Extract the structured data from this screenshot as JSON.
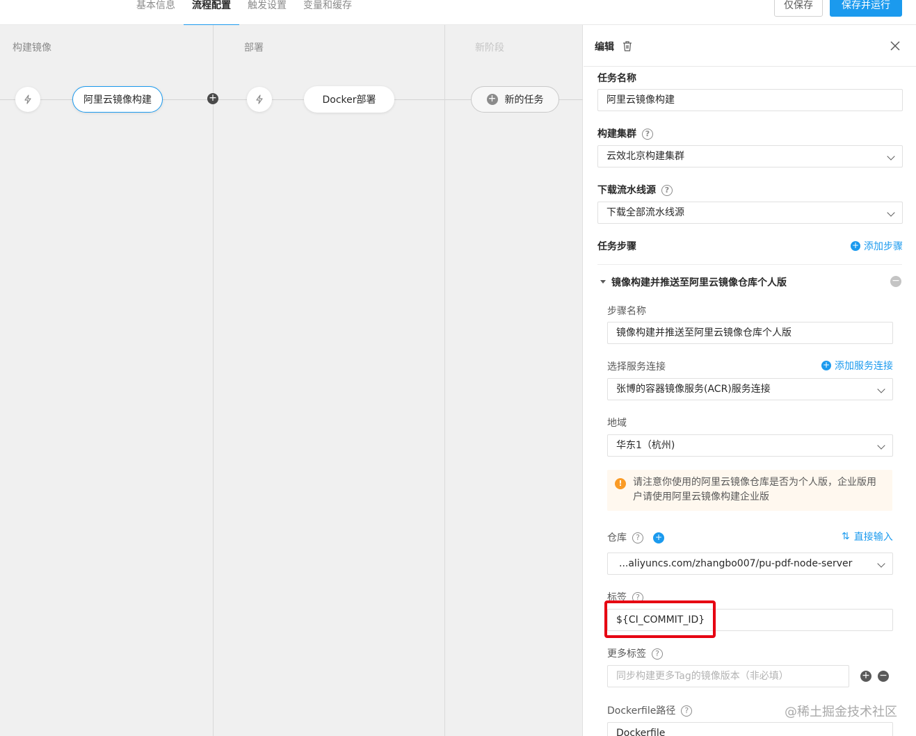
{
  "tabs": [
    "基本信息",
    "流程配置",
    "触发设置",
    "变量和缓存"
  ],
  "active_tab": "流程配置",
  "buttons": {
    "save": "仅保存",
    "save_run": "保存并运行"
  },
  "stages": [
    {
      "title": "构建镜像",
      "job": "阿里云镜像构建"
    },
    {
      "title": "部署",
      "job": "Docker部署"
    },
    {
      "title": "新阶段",
      "job": "新的任务"
    }
  ],
  "panel": {
    "title": "编辑",
    "task_name_label": "任务名称",
    "task_name_value": "阿里云镜像构建",
    "cluster_label": "构建集群",
    "cluster_value": "云效北京构建集群",
    "source_label": "下载流水线源",
    "source_value": "下载全部流水线源",
    "steps_label": "任务步骤",
    "add_step": "添加步骤",
    "step_title": "镜像构建并推送至阿里云镜像仓库个人版",
    "step_name_label": "步骤名称",
    "step_name_value": "镜像构建并推送至阿里云镜像仓库个人版",
    "service_label": "选择服务连接",
    "add_service": "添加服务连接",
    "service_value": "张博的容器镜像服务(ACR)服务连接",
    "region_label": "地域",
    "region_value": "华东1（杭州)",
    "warning": "请注意你使用的阿里云镜像仓库是否为个人版，企业版用户请使用阿里云镜像构建企业版",
    "repo_label": "仓库",
    "direct_input": "直接输入",
    "repo_value": "...aliyuncs.com/zhangbo007/pu-pdf-node-server",
    "tag_label": "标签",
    "tag_value": "${CI_COMMIT_ID}",
    "more_tags_label": "更多标签",
    "more_tags_placeholder": "同步构建更多Tag的镜像版本（非必填）",
    "dockerfile_label": "Dockerfile路径",
    "dockerfile_value": "Dockerfile"
  },
  "watermark": "@稀土掘金技术社区",
  "colors": {
    "accent": "#1b9aee",
    "warning": "#fa9b26",
    "highlight": "#e60012"
  }
}
